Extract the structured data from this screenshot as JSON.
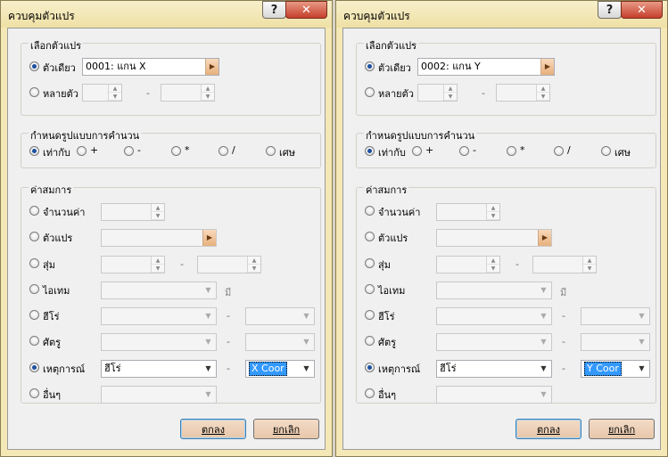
{
  "windows": [
    {
      "title": "ควบคุมตัวแปร",
      "help": "?",
      "close": "✕",
      "group_select": {
        "title": "เลือกตัวแปร",
        "single_label": "ตัวเดียว",
        "single_value": "0001: แกน X",
        "multi_label": "หลายตัว",
        "dash": "-"
      },
      "group_op": {
        "title": "กำหนดรูปแบบการคำนวน",
        "options": [
          "เท่ากับ",
          "+",
          "-",
          "*",
          "/",
          "เศษ"
        ]
      },
      "group_operand": {
        "title": "ค่าสมการ",
        "rows": [
          "จำนวนค่า",
          "ตัวแปร",
          "สุ่ม",
          "ไอเทม",
          "ฮีโร่",
          "ศัตรู",
          "เหตุการณ์",
          "อื่นๆ"
        ],
        "item_suffix": "มี",
        "dash": "-",
        "event_value": "ฮีโร่",
        "event_value2": "X Coor"
      },
      "ok": "ตกลง",
      "cancel": "ยกเลิก"
    },
    {
      "title": "ควบคุมตัวแปร",
      "help": "?",
      "close": "✕",
      "group_select": {
        "title": "เลือกตัวแปร",
        "single_label": "ตัวเดียว",
        "single_value": "0002: แกน Y",
        "multi_label": "หลายตัว",
        "dash": "-"
      },
      "group_op": {
        "title": "กำหนดรูปแบบการคำนวน",
        "options": [
          "เท่ากับ",
          "+",
          "-",
          "*",
          "/",
          "เศษ"
        ]
      },
      "group_operand": {
        "title": "ค่าสมการ",
        "rows": [
          "จำนวนค่า",
          "ตัวแปร",
          "สุ่ม",
          "ไอเทม",
          "ฮีโร่",
          "ศัตรู",
          "เหตุการณ์",
          "อื่นๆ"
        ],
        "item_suffix": "มี",
        "dash": "-",
        "event_value": "ฮีโร่",
        "event_value2": "Y Coor"
      },
      "ok": "ตกลง",
      "cancel": "ยกเลิก"
    }
  ]
}
